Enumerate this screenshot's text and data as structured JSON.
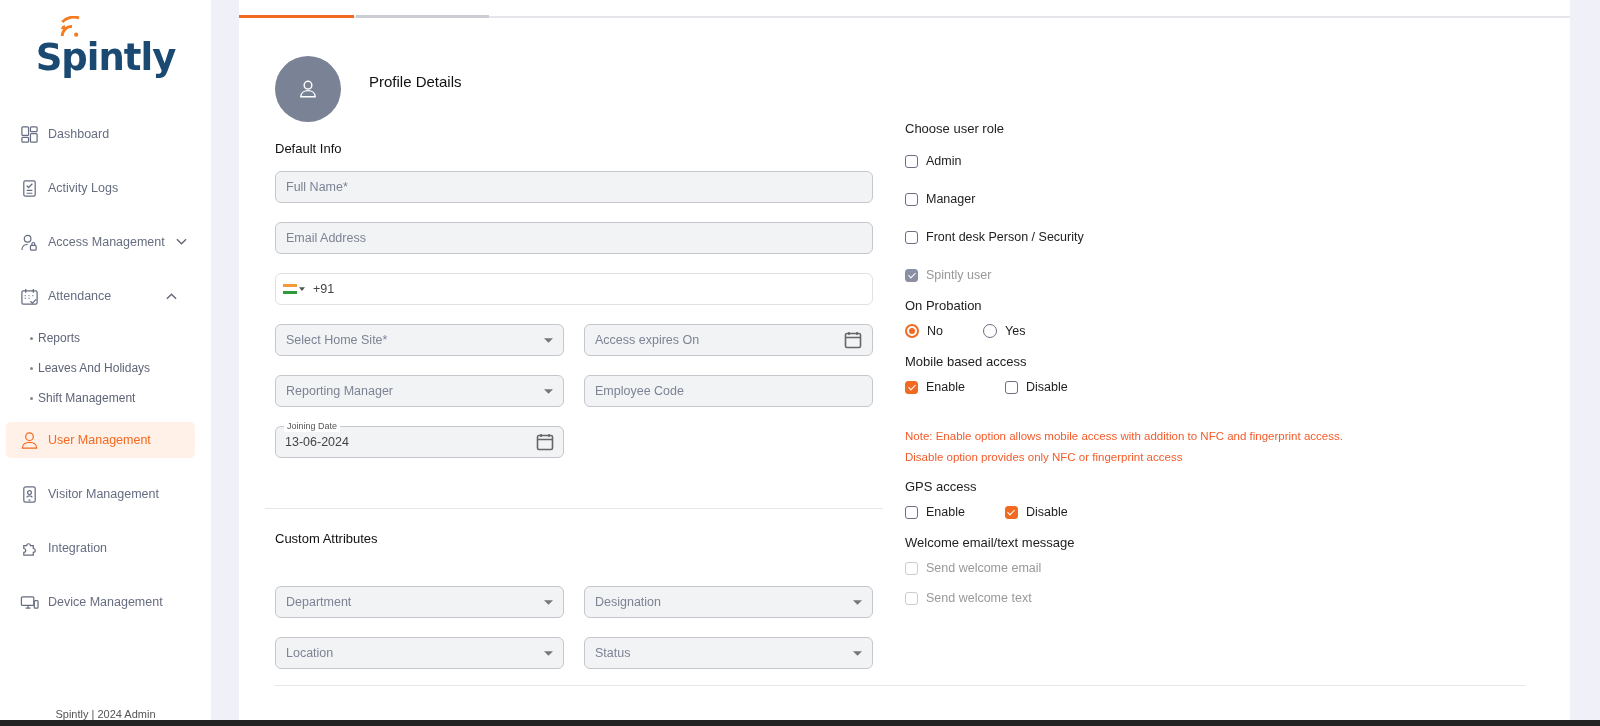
{
  "sidebar": {
    "logo": "Spintly",
    "items": [
      {
        "label": "Dashboard",
        "selected": false
      },
      {
        "label": "Activity Logs",
        "selected": false
      },
      {
        "label": "Access Management",
        "selected": false,
        "expanded": false
      },
      {
        "label": "Attendance",
        "selected": false,
        "expanded": true,
        "children": [
          {
            "label": "Reports",
            "selected": false
          },
          {
            "label": "Leaves And Holidays",
            "selected": false
          },
          {
            "label": "Shift Management",
            "selected": false
          }
        ]
      },
      {
        "label": "User Management",
        "selected": true
      },
      {
        "label": "Visitor Management",
        "selected": false
      },
      {
        "label": "Integration",
        "selected": false
      },
      {
        "label": "Device Management",
        "selected": false
      }
    ],
    "footer": "Spintly | 2024 Admin"
  },
  "steps": [
    {
      "selected": true
    },
    {
      "selected": false
    }
  ],
  "profile": {
    "title": "Profile Details"
  },
  "default_info": {
    "heading": "Default Info",
    "rows": [
      [
        {
          "kind": "text",
          "placeholder": "Full Name*"
        }
      ],
      [
        {
          "kind": "text",
          "placeholder": "Email Address"
        }
      ],
      [
        {
          "kind": "phone",
          "value": "+91"
        }
      ],
      [
        {
          "kind": "select",
          "placeholder": "Select Home Site*"
        },
        {
          "kind": "date",
          "placeholder": "Access expires On"
        }
      ],
      [
        {
          "kind": "select",
          "placeholder": "Reporting Manager"
        },
        {
          "kind": "text",
          "placeholder": "Employee Code"
        }
      ],
      [
        {
          "kind": "date",
          "label": "Joining Date",
          "value": "13-06-2024"
        }
      ]
    ]
  },
  "custom_attributes": {
    "heading": "Custom Attributes",
    "rows": [
      [
        {
          "kind": "select",
          "placeholder": "Department"
        },
        {
          "kind": "select",
          "placeholder": "Designation"
        }
      ],
      [
        {
          "kind": "select",
          "placeholder": "Location"
        },
        {
          "kind": "select",
          "placeholder": "Status"
        }
      ]
    ]
  },
  "user_role": {
    "heading": "Choose user role",
    "options": [
      {
        "label": "Admin",
        "checked": false,
        "disabled": false
      },
      {
        "label": "Manager",
        "checked": false,
        "disabled": false
      },
      {
        "label": "Front desk Person / Security",
        "checked": false,
        "disabled": false
      },
      {
        "label": "Spintly user",
        "checked": true,
        "disabled": true
      }
    ]
  },
  "probation": {
    "heading": "On Probation",
    "options": [
      {
        "label": "No",
        "selected": true
      },
      {
        "label": "Yes",
        "selected": false
      }
    ]
  },
  "mobile_access": {
    "heading": "Mobile based access",
    "options": [
      {
        "label": "Enable",
        "checked": true
      },
      {
        "label": "Disable",
        "checked": false
      }
    ],
    "note": [
      "Note: Enable option allows mobile access with addition to NFC and fingerprint access.",
      "Disable option provides only NFC or fingerprint access"
    ]
  },
  "gps_access": {
    "heading": "GPS access",
    "options": [
      {
        "label": "Enable",
        "checked": false
      },
      {
        "label": "Disable",
        "checked": true
      }
    ]
  },
  "welcome": {
    "heading": "Welcome email/text message",
    "options": [
      {
        "label": "Send welcome email",
        "checked": false,
        "disabled": true
      },
      {
        "label": "Send welcome text",
        "checked": false,
        "disabled": true
      }
    ]
  }
}
